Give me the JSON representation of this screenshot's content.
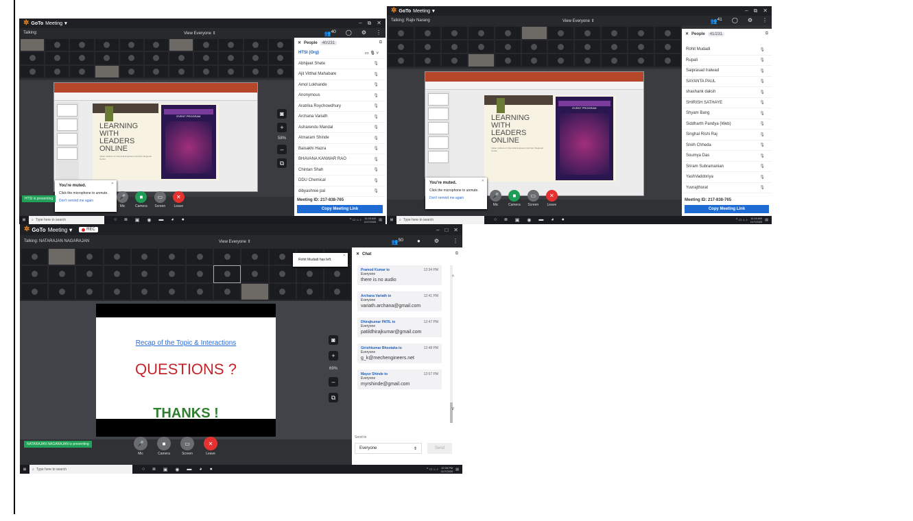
{
  "app": {
    "brand_prefix": "GoTo",
    "brand_suffix": "Meeting",
    "menu_caret": "▾",
    "view_label": "View Everyone"
  },
  "shot1": {
    "talking": "Talking:",
    "attendee_count": "40",
    "zoom": "58%",
    "presenter_banner": "HTSI is presenting",
    "people_title": "People",
    "people_count": "40/231",
    "org_row": "HTSI (Org)",
    "people": [
      {
        "name": "Abhijeet Shete"
      },
      {
        "name": "Ajit Vitthal Mahabare"
      },
      {
        "name": "Amol Lokhande"
      },
      {
        "name": "Anonymous"
      },
      {
        "name": "Aratrika Roychowdhury"
      },
      {
        "name": "Archana Variath"
      },
      {
        "name": "Asharendu Mandal"
      },
      {
        "name": "Atmaram Shinde"
      },
      {
        "name": "Baisakhi Hazra"
      },
      {
        "name": "BHAVANA KANWAR RAO"
      },
      {
        "name": "Chintan Shah"
      },
      {
        "name": "DDU Chemical"
      },
      {
        "name": "dibyashree pal"
      }
    ],
    "meeting_id": "Meeting ID: 217-838-765",
    "copy_link": "Copy Meeting Link",
    "time": "11:03 AM",
    "date": "11/7/2020"
  },
  "shot2": {
    "talking": "Talking: Rajiv Narang",
    "attendee_count": "41",
    "people_title": "People",
    "people_count": "41/231",
    "people": [
      {
        "name": "Rohit Mudadi"
      },
      {
        "name": "Rupali"
      },
      {
        "name": "Saiprasad Iralwad"
      },
      {
        "name": "SAYANTA PAUL"
      },
      {
        "name": "shashank daksh"
      },
      {
        "name": "SHIRISH SATHAYE"
      },
      {
        "name": "Shyam Bang"
      },
      {
        "name": "Siddharth Pandya  (Web)"
      },
      {
        "name": "Singhal Rishi Raj"
      },
      {
        "name": "Snèh Chheda"
      },
      {
        "name": "Soumya Das"
      },
      {
        "name": "Sriram Subramanian"
      },
      {
        "name": "YashVaddoriya"
      },
      {
        "name": "Yuvrajthorat"
      }
    ],
    "meeting_id": "Meeting ID: 217-838-765",
    "copy_link": "Copy Meeting Link",
    "time": "11:04 AM",
    "date": "11/7/2020"
  },
  "shot3": {
    "rec": "REC",
    "talking": "Talking: NATARAJAN NAGARAJAN",
    "attendee_count": "50",
    "zoom": "69%",
    "presenter_banner": "NATARAJAN NAGARAJAN is presenting",
    "notice": "Rohit Mudadi has left.",
    "chat_title": "Chat",
    "messages": [
      {
        "from": "Pramod Kumar",
        "time": "12:34 PM",
        "body": "there is no audio"
      },
      {
        "from": "Archana Variath",
        "time": "12:41 PM",
        "body": "variath.archana@gmail.com"
      },
      {
        "from": "Dhirajkumar PATIL",
        "time": "12:47 PM",
        "body": "patildhirajkumar@gmail.com"
      },
      {
        "from": "Girishkumar Bhootaka",
        "time": "12:48 PM",
        "body": "g_k@mechengineers.net"
      },
      {
        "from": "Mayur Shinde",
        "time": "12:57 PM",
        "body": "myrshinde@gmail.com"
      }
    ],
    "to_word": "to",
    "to_everyone": "Everyone",
    "send_to_label": "Send to",
    "send_to_value": "Everyone",
    "send_button": "Send",
    "slide_link": "Recap of the Topic & Interactions",
    "slide_q": "QUESTIONS ?",
    "slide_thanks": "THANKS !",
    "time": "12:58 PM",
    "date": "11/7/2020"
  },
  "controls": {
    "mic": "Mic",
    "camera": "Camera",
    "screen": "Screen",
    "leave": "Leave"
  },
  "muted": {
    "title": "You're muted.",
    "body": "Click the microphone to unmute.",
    "link": "Don't remind me again"
  },
  "slide": {
    "title": "LEARNING WITH LEADERS ONLINE",
    "subtitle": "Indian Institute of Chemical Engineers Northern Regional Centre",
    "poster_head": "EVENT PROGRAM",
    "poster_tag": "IIChE, NRC"
  },
  "taskbar": {
    "search": "Type here to search"
  },
  "colors": {
    "brand_orange": "#f58a1f",
    "present_green": "#22a15a",
    "leave_red": "#e3322f",
    "link_blue": "#1f6bd4"
  }
}
